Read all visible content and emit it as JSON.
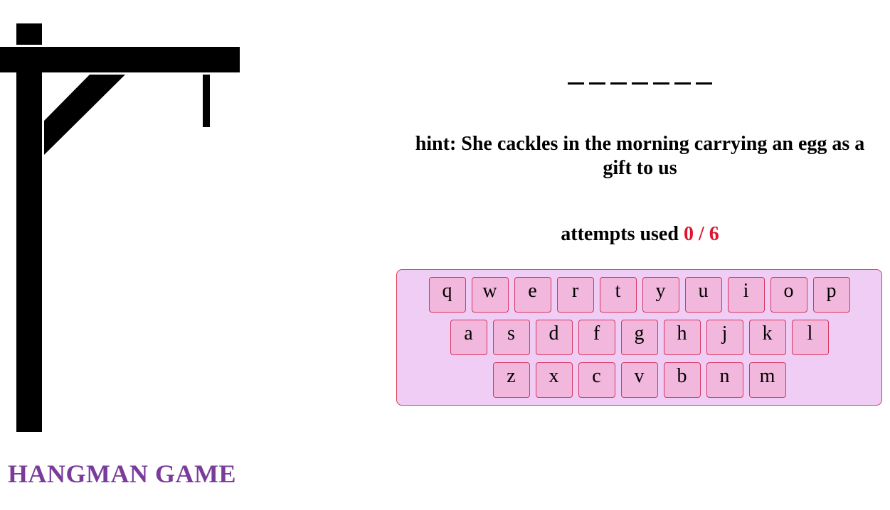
{
  "game": {
    "title": "HANGMAN GAME",
    "word_blanks": [
      "",
      "",
      "",
      "",
      "",
      "",
      ""
    ],
    "hint_label": "hint:",
    "hint_text": "She cackles in the morning carrying an egg as a gift to us",
    "attempts_label": "attempts used",
    "attempts_used": "0",
    "attempts_separator": "/",
    "attempts_max": "6"
  },
  "keyboard": {
    "rows": [
      [
        "q",
        "w",
        "e",
        "r",
        "t",
        "y",
        "u",
        "i",
        "o",
        "p"
      ],
      [
        "a",
        "s",
        "d",
        "f",
        "g",
        "h",
        "j",
        "k",
        "l"
      ],
      [
        "z",
        "x",
        "c",
        "v",
        "b",
        "n",
        "m"
      ]
    ]
  },
  "colors": {
    "title": "#7a3b9a",
    "attempts_count": "#e0142e",
    "keyboard_bg": "#efcdf4",
    "key_bg": "#f2b7dc",
    "key_border": "#d8355e"
  }
}
